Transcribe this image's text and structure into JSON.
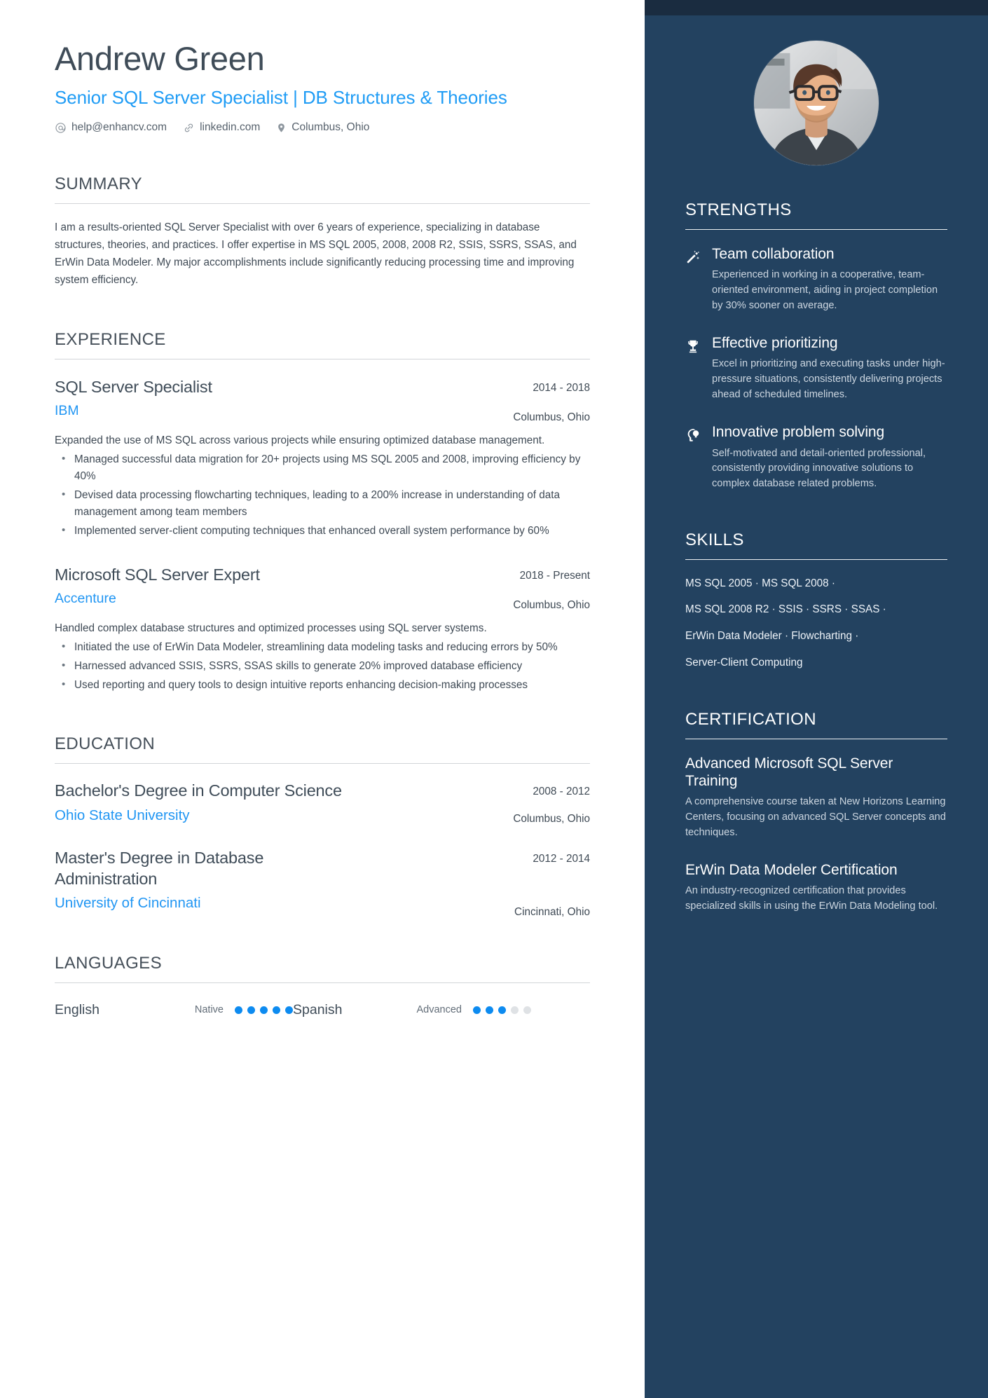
{
  "theme": {
    "accent_blue": "#2196f3",
    "headline_blue": "#1f9cf5",
    "sidebar_bg": "#234260",
    "sidebar_topbar": "#1a2c40",
    "dot_on": "#0d8bf0",
    "dot_off": "#dfe2e5"
  },
  "header": {
    "name": "Andrew Green",
    "headline": "Senior SQL Server Specialist | DB Structures & Theories",
    "contacts": [
      {
        "icon": "at-icon",
        "text": "help@enhancv.com"
      },
      {
        "icon": "link-icon",
        "text": "linkedin.com"
      },
      {
        "icon": "location-icon",
        "text": "Columbus, Ohio"
      }
    ]
  },
  "summary": {
    "title": "SUMMARY",
    "text": "I am a results-oriented SQL Server Specialist with over 6 years of experience, specializing in database structures, theories, and practices. I offer expertise in MS SQL 2005, 2008, 2008 R2, SSIS, SSRS, SSAS, and ErWin Data Modeler. My major accomplishments include significantly reducing processing time and improving system efficiency."
  },
  "experience": {
    "title": "EXPERIENCE",
    "entries": [
      {
        "job_title": "SQL Server Specialist",
        "company": "IBM",
        "date": "2014 - 2018",
        "location": "Columbus, Ohio",
        "description": "Expanded the use of MS SQL across various projects while ensuring optimized database management.",
        "bullets": [
          "Managed successful data migration for 20+ projects using MS SQL 2005 and 2008, improving efficiency by 40%",
          "Devised data processing flowcharting techniques, leading to a 200% increase in understanding of data management among team members",
          "Implemented server-client computing techniques that enhanced overall system performance by 60%"
        ]
      },
      {
        "job_title": "Microsoft SQL Server Expert",
        "company": "Accenture",
        "date": "2018 - Present",
        "location": "Columbus, Ohio",
        "description": "Handled complex database structures and optimized processes using SQL server systems.",
        "bullets": [
          "Initiated the use of ErWin Data Modeler, streamlining data modeling tasks and reducing errors by 50%",
          "Harnessed advanced SSIS, SSRS, SSAS skills to generate 20% improved database efficiency",
          "Used reporting and query tools to design intuitive reports enhancing decision-making processes"
        ]
      }
    ]
  },
  "education": {
    "title": "EDUCATION",
    "entries": [
      {
        "degree": "Bachelor's Degree in Computer Science",
        "school": "Ohio State University",
        "date": "2008 - 2012",
        "location": "Columbus, Ohio"
      },
      {
        "degree": "Master's Degree in Database Administration",
        "school": "University of Cincinnati",
        "date": "2012 - 2014",
        "location": "Cincinnati, Ohio"
      }
    ]
  },
  "languages": {
    "title": "LANGUAGES",
    "items": [
      {
        "name": "English",
        "level": "Native",
        "filled": 5,
        "total": 5
      },
      {
        "name": "Spanish",
        "level": "Advanced",
        "filled": 3,
        "total": 5
      }
    ]
  },
  "strengths": {
    "title": "STRENGTHS",
    "items": [
      {
        "icon": "magic-wand-icon",
        "title": "Team collaboration",
        "text": "Experienced in working in a cooperative, team-oriented environment, aiding in project completion by 30% sooner on average."
      },
      {
        "icon": "trophy-icon",
        "title": "Effective prioritizing",
        "text": "Excel in prioritizing and executing tasks under high-pressure situations, consistently delivering projects ahead of scheduled timelines."
      },
      {
        "icon": "idea-head-icon",
        "title": "Innovative problem solving",
        "text": "Self-motivated and detail-oriented professional, consistently providing innovative solutions to complex database related problems."
      }
    ]
  },
  "skills": {
    "title": "SKILLS",
    "lines": [
      "MS SQL 2005 · MS SQL 2008 ·",
      "MS SQL 2008 R2 · SSIS · SSRS · SSAS ·",
      "ErWin Data Modeler · Flowcharting ·",
      "Server-Client Computing"
    ]
  },
  "certification": {
    "title": "CERTIFICATION",
    "items": [
      {
        "title": "Advanced Microsoft SQL Server Training",
        "text": "A comprehensive course taken at New Horizons Learning Centers, focusing on advanced SQL Server concepts and techniques."
      },
      {
        "title": "ErWin Data Modeler Certification",
        "text": "An industry-recognized certification that provides specialized skills in using the ErWin Data Modeling tool."
      }
    ]
  }
}
